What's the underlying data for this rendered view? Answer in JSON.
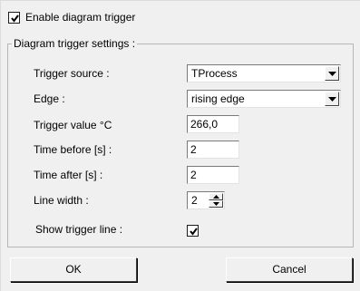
{
  "enable": {
    "label": "Enable diagram trigger",
    "checked": true
  },
  "group": {
    "title": "Diagram trigger settings :"
  },
  "fields": {
    "trigger_source": {
      "label": "Trigger source :",
      "value": "TProcess"
    },
    "edge": {
      "label": "Edge :",
      "value": "rising edge"
    },
    "trigger_value": {
      "label": "Trigger value °C",
      "value": "266,0"
    },
    "time_before": {
      "label": "Time before [s] :",
      "value": "2"
    },
    "time_after": {
      "label": "Time after [s] :",
      "value": "2"
    },
    "line_width": {
      "label": "Line width :",
      "value": "2"
    },
    "show_trigger_line": {
      "label": "Show trigger line :",
      "checked": true
    }
  },
  "buttons": {
    "ok": "OK",
    "cancel": "Cancel"
  },
  "icons": {
    "check": "check-icon",
    "dropdown": "chevron-down-icon",
    "spin_up": "triangle-up-icon",
    "spin_down": "triangle-down-icon"
  }
}
